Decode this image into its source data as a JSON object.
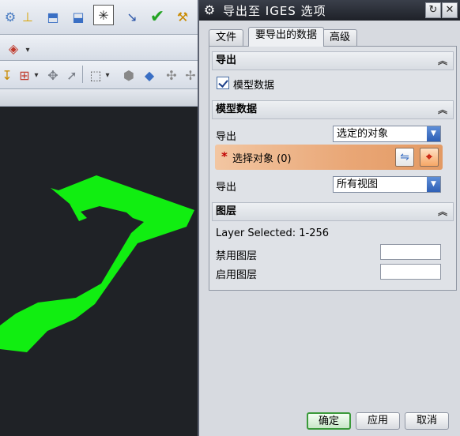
{
  "dialog": {
    "title": "导出至 IGES 选项",
    "icons": {
      "settings": "gear-icon",
      "reset": "reset-icon",
      "close": "close-icon"
    }
  },
  "tabs": [
    {
      "label": "文件",
      "active": false
    },
    {
      "label": "要导出的数据",
      "active": true
    },
    {
      "label": "高级",
      "active": false
    }
  ],
  "sections": {
    "export": {
      "header": "导出",
      "checkbox_label": "模型数据",
      "checked": true
    },
    "model_data": {
      "header": "模型数据",
      "export_label_1": "导出",
      "export_value_1": "选定的对象",
      "select_required_star": "*",
      "select_label": "选择对象 (0)",
      "export_label_2": "导出",
      "export_value_2": "所有视图"
    },
    "layers": {
      "header": "图层",
      "layer_selected": "Layer Selected: 1-256",
      "disable_label": "禁用图层",
      "enable_label": "启用图层",
      "disable_value": "",
      "enable_value": ""
    }
  },
  "buttons": {
    "ok": "确定",
    "apply": "应用",
    "cancel": "取消"
  },
  "colors": {
    "model": "#11ee11",
    "viewport_bg": "#1f2226",
    "selection_highlight": "#e9a675",
    "ok_border": "#3a9a3a"
  }
}
